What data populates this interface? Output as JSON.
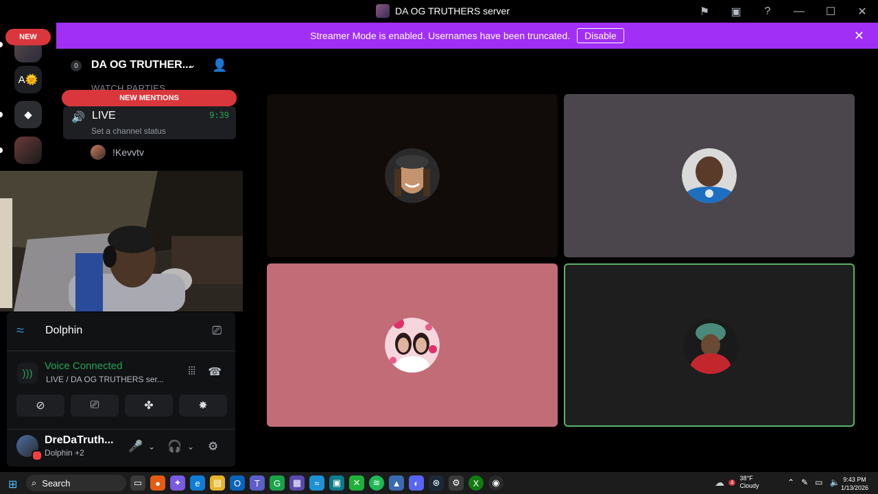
{
  "window": {
    "title": "DA OG TRUTHERS server"
  },
  "banner": {
    "text": "Streamer Mode is enabled. Usernames have been truncated.",
    "button": "Disable"
  },
  "servers": {
    "new_label": "NEW",
    "a_label": "A🌞"
  },
  "channel_list": {
    "server_name": "DA OG TRUTHER...",
    "boost_count": "0",
    "category": "WATCH PARTIES",
    "new_mentions": "NEW MENTIONS",
    "live_channel": {
      "name": "LIVE",
      "timer": "9:39",
      "status": "Set a channel status"
    },
    "voice_user": "!Kevvtv"
  },
  "activity": {
    "name": "Dolphin"
  },
  "voice": {
    "status": "Voice Connected",
    "channel": "LIVE / DA OG TRUTHERS ser..."
  },
  "user": {
    "name": "DreDaTruth...",
    "activity": "Dolphin +2"
  },
  "tiles": [
    {
      "bg": "#110b09",
      "speaking": false
    },
    {
      "bg": "#4a464c",
      "speaking": false
    },
    {
      "bg": "#c16c76",
      "speaking": false
    },
    {
      "bg": "#1e1e1e",
      "speaking": true
    }
  ],
  "taskbar": {
    "search": "Search",
    "temp": "38°F",
    "weather": "Cloudy",
    "weather_badge": "4",
    "time": "9:43 PM",
    "date": "1/13/2026"
  }
}
